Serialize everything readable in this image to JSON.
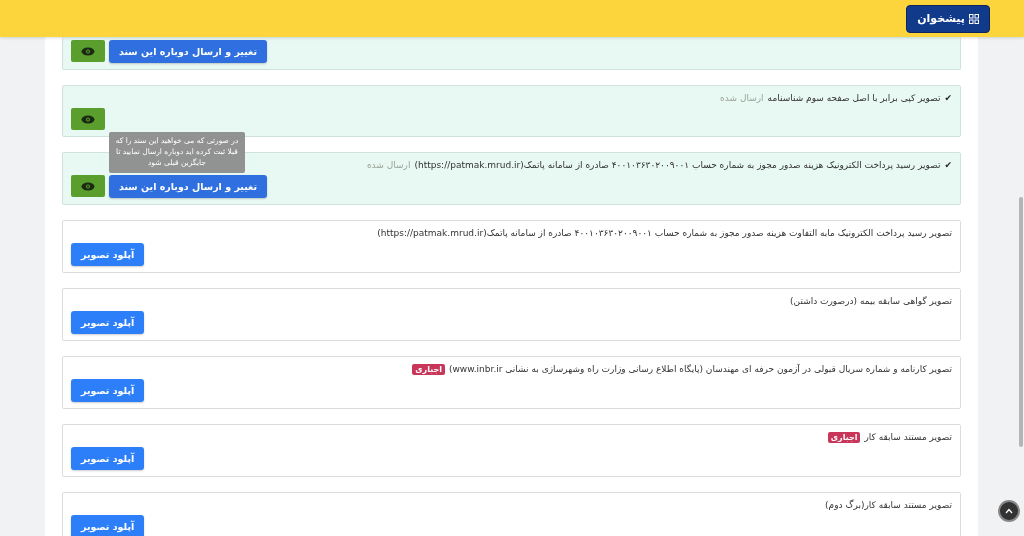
{
  "header": {
    "button": "پیشخوان"
  },
  "documents": [
    {
      "kind": "sent",
      "buttons": [
        {
          "kind": "view"
        },
        {
          "kind": "change",
          "label": "تغییر و ارسال دوباره این سند"
        }
      ]
    },
    {
      "kind": "sent",
      "check": "✔",
      "title": "تصویر کپی برابر با اصل صفحه سوم شناسنامه",
      "status": "ارسال شده",
      "buttons": [
        {
          "kind": "view"
        }
      ]
    },
    {
      "kind": "sent",
      "check": "✔",
      "title": "تصویر رسید پرداخت الکترونیک هزینه صدور مجوز به شماره حساب ۴۰۰۱۰۳۶۳۰۲۰۰۹۰۰۱ صادره از سامانه پاتمک(https://patmak.mrud.ir)",
      "status": "ارسال شده",
      "buttons": [
        {
          "kind": "view"
        },
        {
          "kind": "change",
          "label": "تغییر و ارسال دوباره این سند",
          "tooltip": "در صورتی که می خواهید این سند را که قبلا ثبت کرده اید دوباره ارسال نمایید تا جایگزین قبلی شود"
        }
      ]
    },
    {
      "kind": "pending",
      "title": "تصویر رسید پرداخت الکترونیک مابه التفاوت هزینه صدور مجوز به شماره حساب ۴۰۰۱۰۳۶۳۰۲۰۰۹۰۰۱ صادره از سامانه پاتمک(https://patmak.mrud.ir)",
      "buttons": [
        {
          "kind": "upload",
          "label": "آپلود تصویر"
        }
      ]
    },
    {
      "kind": "pending",
      "title": "تصویر گواهی سابقه بیمه (درصورت داشتن)",
      "buttons": [
        {
          "kind": "upload",
          "label": "آپلود تصویر"
        }
      ]
    },
    {
      "kind": "pending",
      "title": "تصویر کارنامه و شماره سریال قبولی در آزمون حرفه ای مهندسان (پایگاه اطلاع رسانی وزارت راه وشهرسازی به نشانی www.inbr.ir)",
      "badge": "اجباری",
      "buttons": [
        {
          "kind": "upload",
          "label": "آپلود تصویر"
        }
      ]
    },
    {
      "kind": "pending",
      "title": "تصویر مستند سابقه کار",
      "badge": "اجباری",
      "buttons": [
        {
          "kind": "upload",
          "label": "آپلود تصویر"
        }
      ]
    },
    {
      "kind": "pending",
      "title": "تصویر مستند سابقه کار(برگ دوم)",
      "buttons": [
        {
          "kind": "upload",
          "label": "آپلود تصویر"
        }
      ]
    }
  ]
}
